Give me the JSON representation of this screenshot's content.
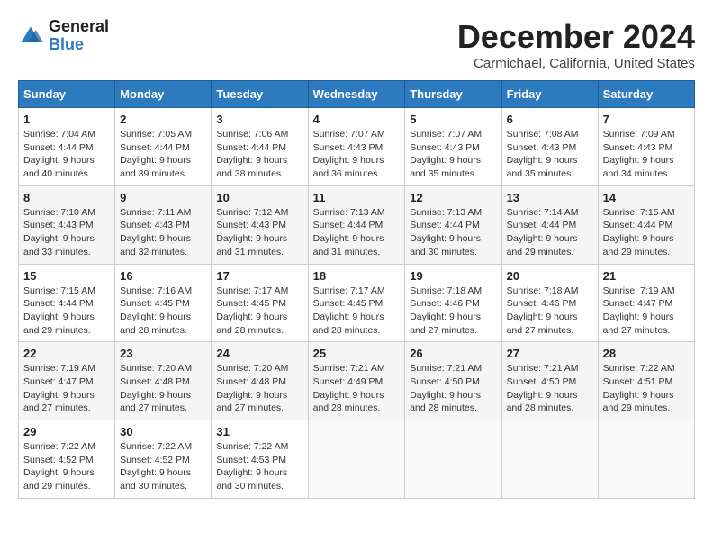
{
  "logo": {
    "general": "General",
    "blue": "Blue"
  },
  "title": "December 2024",
  "location": "Carmichael, California, United States",
  "headers": [
    "Sunday",
    "Monday",
    "Tuesday",
    "Wednesday",
    "Thursday",
    "Friday",
    "Saturday"
  ],
  "weeks": [
    [
      {
        "day": "1",
        "sunrise": "7:04 AM",
        "sunset": "4:44 PM",
        "daylight": "9 hours and 40 minutes."
      },
      {
        "day": "2",
        "sunrise": "7:05 AM",
        "sunset": "4:44 PM",
        "daylight": "9 hours and 39 minutes."
      },
      {
        "day": "3",
        "sunrise": "7:06 AM",
        "sunset": "4:44 PM",
        "daylight": "9 hours and 38 minutes."
      },
      {
        "day": "4",
        "sunrise": "7:07 AM",
        "sunset": "4:43 PM",
        "daylight": "9 hours and 36 minutes."
      },
      {
        "day": "5",
        "sunrise": "7:07 AM",
        "sunset": "4:43 PM",
        "daylight": "9 hours and 35 minutes."
      },
      {
        "day": "6",
        "sunrise": "7:08 AM",
        "sunset": "4:43 PM",
        "daylight": "9 hours and 35 minutes."
      },
      {
        "day": "7",
        "sunrise": "7:09 AM",
        "sunset": "4:43 PM",
        "daylight": "9 hours and 34 minutes."
      }
    ],
    [
      {
        "day": "8",
        "sunrise": "7:10 AM",
        "sunset": "4:43 PM",
        "daylight": "9 hours and 33 minutes."
      },
      {
        "day": "9",
        "sunrise": "7:11 AM",
        "sunset": "4:43 PM",
        "daylight": "9 hours and 32 minutes."
      },
      {
        "day": "10",
        "sunrise": "7:12 AM",
        "sunset": "4:43 PM",
        "daylight": "9 hours and 31 minutes."
      },
      {
        "day": "11",
        "sunrise": "7:13 AM",
        "sunset": "4:44 PM",
        "daylight": "9 hours and 31 minutes."
      },
      {
        "day": "12",
        "sunrise": "7:13 AM",
        "sunset": "4:44 PM",
        "daylight": "9 hours and 30 minutes."
      },
      {
        "day": "13",
        "sunrise": "7:14 AM",
        "sunset": "4:44 PM",
        "daylight": "9 hours and 29 minutes."
      },
      {
        "day": "14",
        "sunrise": "7:15 AM",
        "sunset": "4:44 PM",
        "daylight": "9 hours and 29 minutes."
      }
    ],
    [
      {
        "day": "15",
        "sunrise": "7:15 AM",
        "sunset": "4:44 PM",
        "daylight": "9 hours and 29 minutes."
      },
      {
        "day": "16",
        "sunrise": "7:16 AM",
        "sunset": "4:45 PM",
        "daylight": "9 hours and 28 minutes."
      },
      {
        "day": "17",
        "sunrise": "7:17 AM",
        "sunset": "4:45 PM",
        "daylight": "9 hours and 28 minutes."
      },
      {
        "day": "18",
        "sunrise": "7:17 AM",
        "sunset": "4:45 PM",
        "daylight": "9 hours and 28 minutes."
      },
      {
        "day": "19",
        "sunrise": "7:18 AM",
        "sunset": "4:46 PM",
        "daylight": "9 hours and 27 minutes."
      },
      {
        "day": "20",
        "sunrise": "7:18 AM",
        "sunset": "4:46 PM",
        "daylight": "9 hours and 27 minutes."
      },
      {
        "day": "21",
        "sunrise": "7:19 AM",
        "sunset": "4:47 PM",
        "daylight": "9 hours and 27 minutes."
      }
    ],
    [
      {
        "day": "22",
        "sunrise": "7:19 AM",
        "sunset": "4:47 PM",
        "daylight": "9 hours and 27 minutes."
      },
      {
        "day": "23",
        "sunrise": "7:20 AM",
        "sunset": "4:48 PM",
        "daylight": "9 hours and 27 minutes."
      },
      {
        "day": "24",
        "sunrise": "7:20 AM",
        "sunset": "4:48 PM",
        "daylight": "9 hours and 27 minutes."
      },
      {
        "day": "25",
        "sunrise": "7:21 AM",
        "sunset": "4:49 PM",
        "daylight": "9 hours and 28 minutes."
      },
      {
        "day": "26",
        "sunrise": "7:21 AM",
        "sunset": "4:50 PM",
        "daylight": "9 hours and 28 minutes."
      },
      {
        "day": "27",
        "sunrise": "7:21 AM",
        "sunset": "4:50 PM",
        "daylight": "9 hours and 28 minutes."
      },
      {
        "day": "28",
        "sunrise": "7:22 AM",
        "sunset": "4:51 PM",
        "daylight": "9 hours and 29 minutes."
      }
    ],
    [
      {
        "day": "29",
        "sunrise": "7:22 AM",
        "sunset": "4:52 PM",
        "daylight": "9 hours and 29 minutes."
      },
      {
        "day": "30",
        "sunrise": "7:22 AM",
        "sunset": "4:52 PM",
        "daylight": "9 hours and 30 minutes."
      },
      {
        "day": "31",
        "sunrise": "7:22 AM",
        "sunset": "4:53 PM",
        "daylight": "9 hours and 30 minutes."
      },
      null,
      null,
      null,
      null
    ]
  ]
}
